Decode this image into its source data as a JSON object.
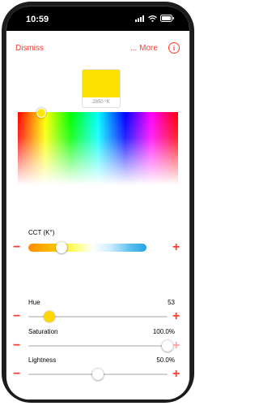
{
  "status": {
    "time": "10:59"
  },
  "topbar": {
    "dismiss": "Dismiss",
    "more": "... More",
    "info": "i"
  },
  "swatch": {
    "color": "#fce000",
    "label": "2850 °K"
  },
  "cct": {
    "label": "CCT (K°)",
    "value_fraction": 0.28
  },
  "hue": {
    "label": "Hue",
    "value": "53",
    "value_fraction": 0.15
  },
  "saturation": {
    "label": "Saturation",
    "value": "100.0%",
    "value_fraction": 1.0
  },
  "lightness": {
    "label": "Lightness",
    "value": "50.0%",
    "value_fraction": 0.5
  },
  "controls": {
    "minus": "−",
    "plus": "+"
  },
  "colors": {
    "accent": "#ff3b30",
    "knob_yellow": "#ffd700"
  }
}
